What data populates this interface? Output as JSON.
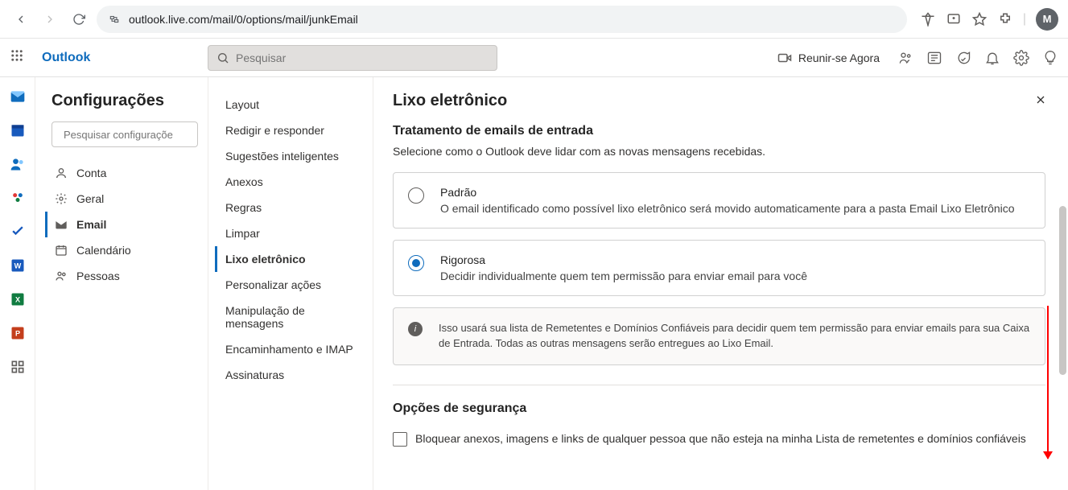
{
  "browser": {
    "url": "outlook.live.com/mail/0/options/mail/junkEmail",
    "avatar_initial": "M"
  },
  "header": {
    "brand": "Outlook",
    "search_placeholder": "Pesquisar",
    "meet_now": "Reunir-se Agora"
  },
  "settings": {
    "title": "Configurações",
    "search_placeholder": "Pesquisar configuraçõe",
    "categories": [
      {
        "icon": "person",
        "label": "Conta"
      },
      {
        "icon": "gear",
        "label": "Geral"
      },
      {
        "icon": "mail",
        "label": "Email",
        "active": true
      },
      {
        "icon": "calendar",
        "label": "Calendário"
      },
      {
        "icon": "people",
        "label": "Pessoas"
      }
    ],
    "sub_items": [
      "Layout",
      "Redigir e responder",
      "Sugestões inteligentes",
      "Anexos",
      "Regras",
      "Limpar",
      "Lixo eletrônico",
      "Personalizar ações",
      "Manipulação de mensagens",
      "Encaminhamento e IMAP",
      "Assinaturas"
    ],
    "sub_active_index": 6
  },
  "content": {
    "page_title": "Lixo eletrônico",
    "section1": {
      "heading": "Tratamento de emails de entrada",
      "description": "Selecione como o Outlook deve lidar com as novas mensagens recebidas.",
      "options": [
        {
          "title": "Padrão",
          "desc": "O email identificado como possível lixo eletrônico será movido automaticamente para a pasta Email Lixo Eletrônico",
          "checked": false
        },
        {
          "title": "Rigorosa",
          "desc": "Decidir individualmente quem tem permissão para enviar email para você",
          "checked": true
        }
      ],
      "info": "Isso usará sua lista de Remetentes e Domínios Confiáveis para decidir quem tem permissão para enviar emails para sua Caixa de Entrada. Todas as outras mensagens serão entregues ao Lixo Email."
    },
    "section2": {
      "heading": "Opções de segurança",
      "checkbox1": "Bloquear anexos, imagens e links de qualquer pessoa que não esteja na minha Lista de remetentes e domínios confiáveis"
    }
  }
}
